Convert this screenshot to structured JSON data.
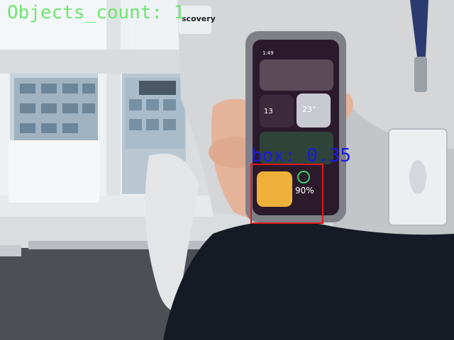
{
  "overlay": {
    "objects_count_text": "Objects_count: 1",
    "detection_label": "box: 0.35",
    "colors": {
      "count_text": "#6ee66e",
      "box_stroke": "#e01818",
      "label_text": "#1a1ae6"
    }
  },
  "phone_screen": {
    "time": "1:49",
    "calendar_day": "13",
    "temperature": "23°",
    "battery_percent": "90%"
  },
  "background_text": {
    "shirt_brand": "scovery"
  }
}
